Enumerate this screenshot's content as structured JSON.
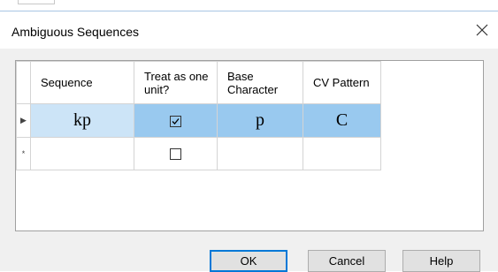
{
  "dialog": {
    "title": "Ambiguous Sequences",
    "close_icon": "close-icon"
  },
  "grid": {
    "columns": [
      "Sequence",
      "Treat as one unit?",
      "Base Character",
      "CV Pattern"
    ],
    "rows": [
      {
        "indicator": "▶",
        "sequence": "kp",
        "treat_as_unit": true,
        "base_character": "p",
        "cv_pattern": "C",
        "selected": true
      },
      {
        "indicator": "*",
        "sequence": "",
        "treat_as_unit": false,
        "base_character": "",
        "cv_pattern": "",
        "selected": false
      }
    ]
  },
  "buttons": {
    "ok": "OK",
    "cancel": "Cancel",
    "help": "Help"
  },
  "colors": {
    "selection": "#99c9ef",
    "selection_light": "#cce4f7",
    "default_button_border": "#0078d7"
  }
}
